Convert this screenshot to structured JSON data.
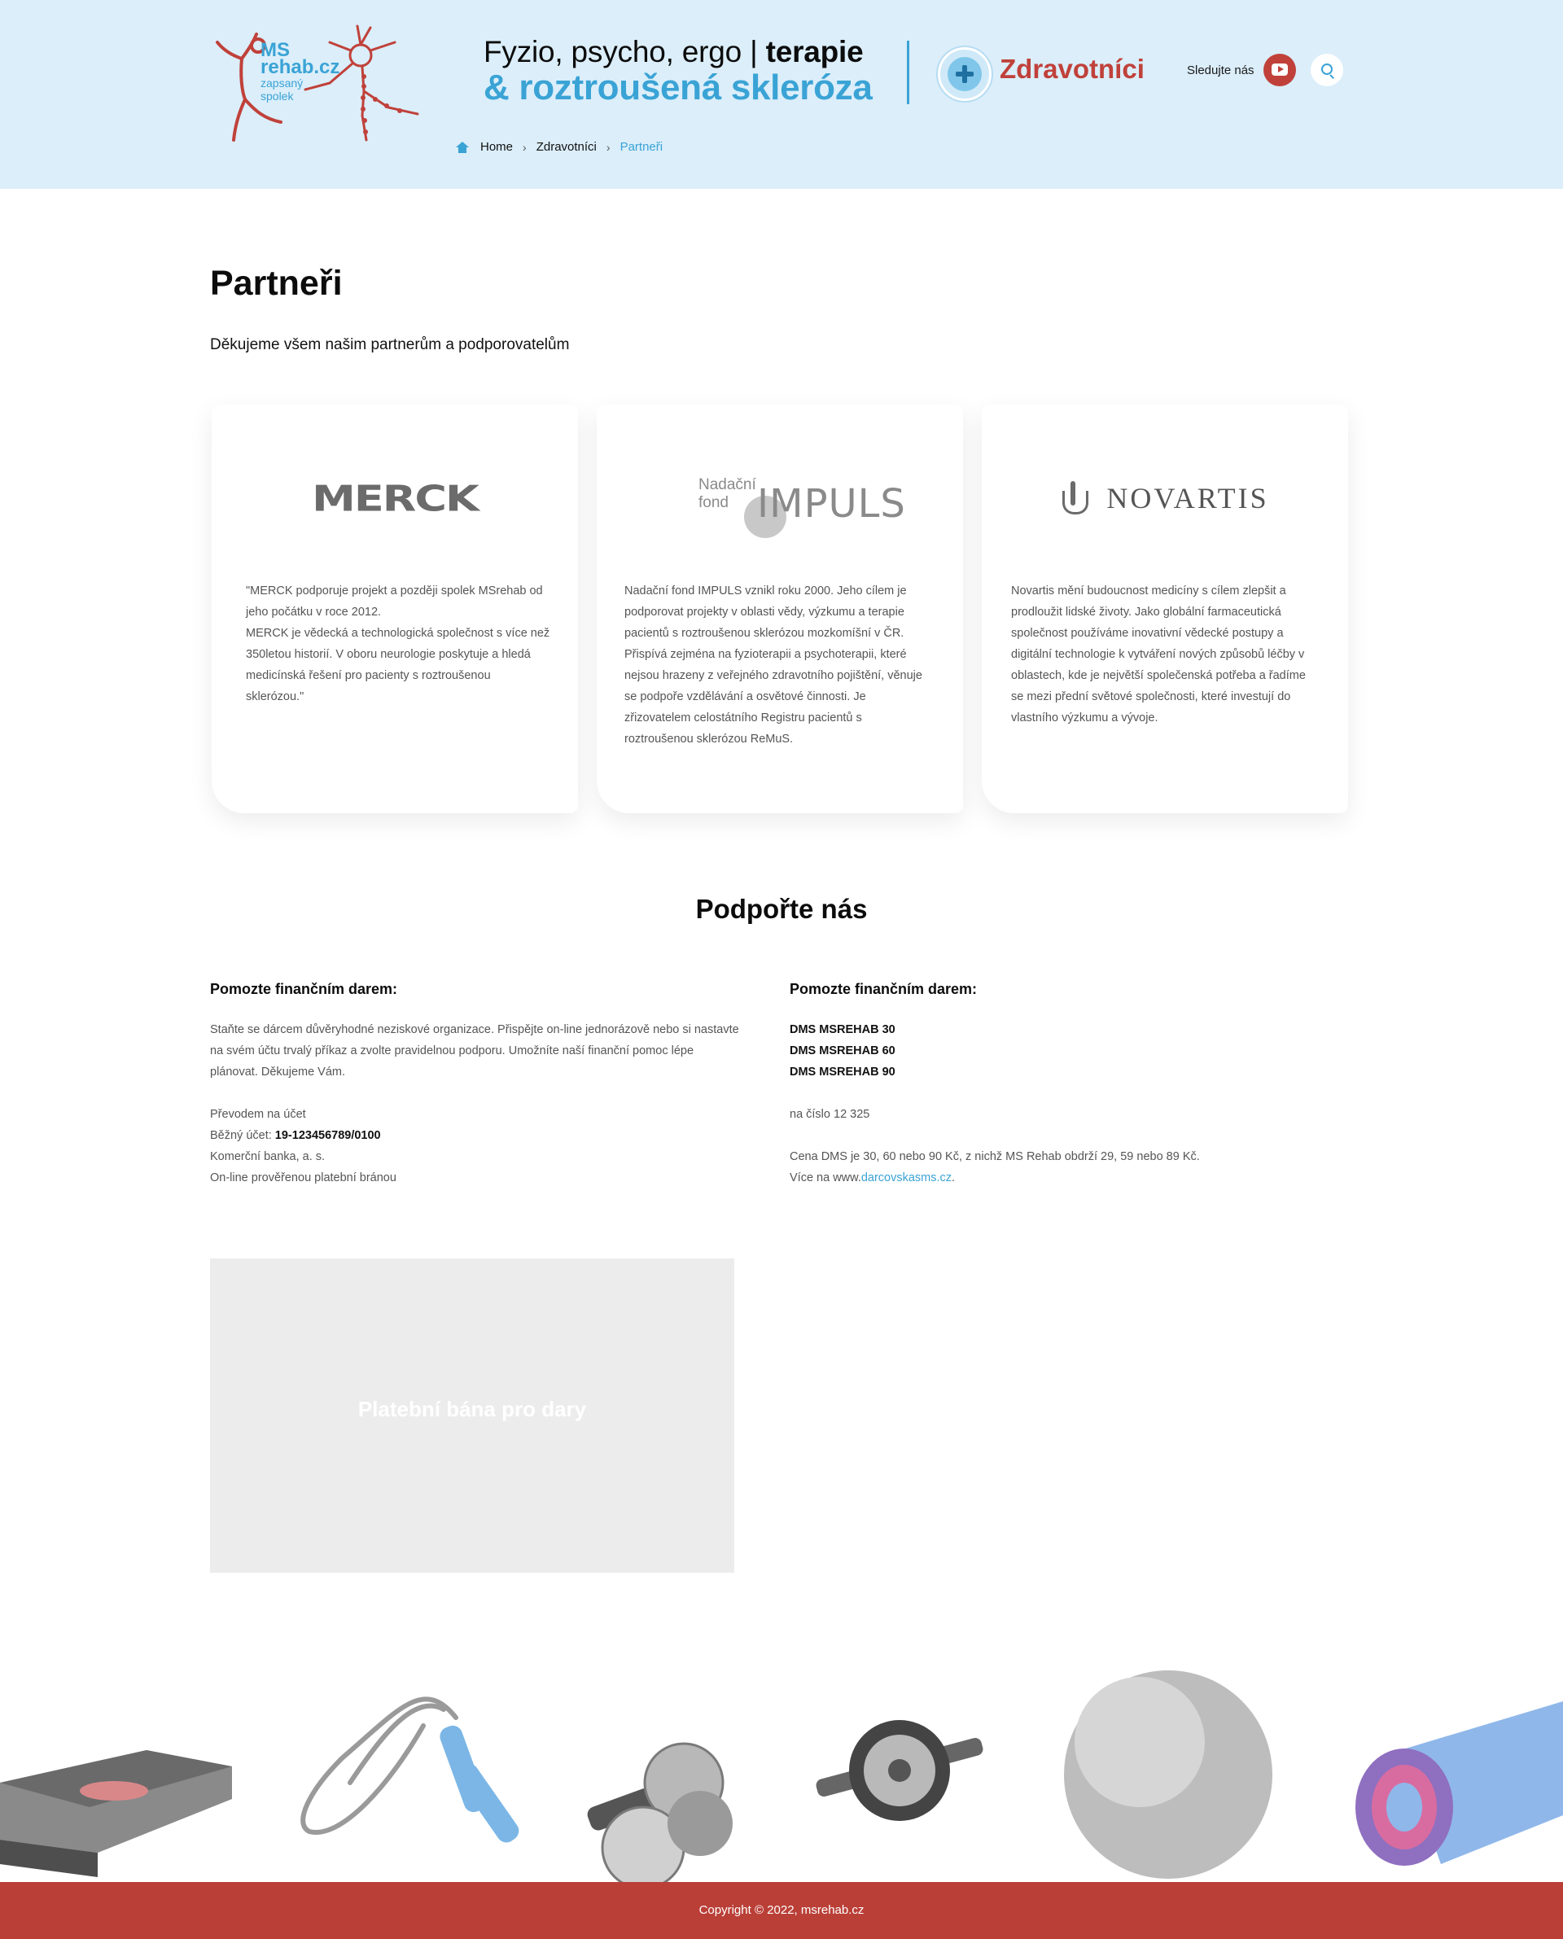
{
  "header": {
    "logo": {
      "line1": "MS",
      "line2": "rehab.cz",
      "line3": "zapsaný",
      "line4": "spolek"
    },
    "tagline": {
      "part1": "Fyzio, psycho, ergo | ",
      "part1_bold": "terapie",
      "part2": "& roztroušená skleróza"
    },
    "section_label": "Zdravotníci",
    "follow_label": "Sledujte nás",
    "breadcrumb": {
      "home": "Home",
      "parent": "Zdravotníci",
      "current": "Partneři"
    },
    "colors": {
      "background": "#dbeefa",
      "accent": "#3aa3d5",
      "brand_red": "#c0413a"
    }
  },
  "page": {
    "title": "Partneři",
    "subtitle": "Děkujeme všem našim partnerům a podporovatelům"
  },
  "partners": [
    {
      "logo_text": "MERCK",
      "text": "\"MERCK podporuje projekt a později spolek MSrehab od jeho počátku v roce 2012.\nMERCK je vědecká a technologická společnost s více než 350letou historií. V oboru neurologie poskytuje a hledá medicínská řešení pro pacienty s roztroušenou sklerózou.\""
    },
    {
      "logo_small": "Nadační fond",
      "logo_big": "IMPULS",
      "text": "Nadační fond IMPULS vznikl roku 2000. Jeho cílem je podporovat projekty v oblasti vědy, výzkumu a terapie pacientů s roztroušenou sklerózou mozkomíšní v ČR. Přispívá zejména na fyzioterapii a psychoterapii, které nejsou hrazeny z veřejného zdravotního pojištění, věnuje se podpoře vzdělávání a osvětové činnosti. Je zřizovatelem celostátního Registru pacientů s roztroušenou sklerózou ReMuS."
    },
    {
      "logo_text": "NOVARTIS",
      "text": "Novartis mění budoucnost medicíny s cílem zlepšit a prodloužit lidské životy. Jako globální farmaceutická společnost používáme inovativní vědecké postupy a digitální technologie k vytváření nových způsobů léčby v oblastech, kde je největší společenská potřeba a řadíme se mezi přední světové společnosti, které investují do vlastního výzkumu a vývoje."
    }
  ],
  "support": {
    "title": "Podpořte nás",
    "left": {
      "heading": "Pomozte finančním darem:",
      "intro": "Staňte se dárcem důvěryhodné neziskové organizace. Přispějte on-line jednorázově nebo si nastavte na svém účtu trvalý příkaz a zvolte pravidelnou podporu. Umožníte naší finanční pomoc lépe plánovat. Děkujeme Vám.",
      "transfer_label": "Převodem na účet",
      "account_label": "Běžný účet: ",
      "account_number": "19-123456789/0100",
      "bank": "Komerční banka, a. s.",
      "online": "On-line prověřenou platební bránou"
    },
    "right": {
      "heading": "Pomozte finančním darem:",
      "dms": [
        "DMS MSREHAB 30",
        "DMS MSREHAB 60",
        "DMS MSREHAB 90"
      ],
      "number_text": "na číslo 12 325",
      "price_text": "Cena DMS je 30, 60 nebo 90 Kč, z nichž MS Rehab obdrží 29, 59 nebo 89 Kč.",
      "more_prefix": "Více na www.",
      "more_link": "darcovskasms.cz",
      "more_suffix": "."
    },
    "payment_placeholder": "Platební bána pro dary"
  },
  "footer": {
    "copyright": "Copyright © 2022, msrehab.cz",
    "color": "#ba3f37"
  }
}
